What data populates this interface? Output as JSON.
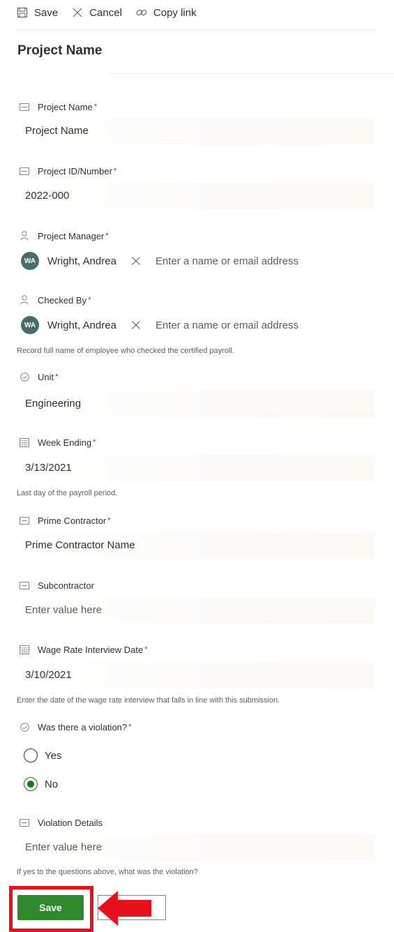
{
  "toolbar": {
    "save_label": "Save",
    "cancel_label": "Cancel",
    "copy_link_label": "Copy link"
  },
  "page_title": "Project Name",
  "required_marker": "*",
  "fields": {
    "project_name": {
      "label": "Project Name",
      "required": true,
      "value": "Project Name"
    },
    "project_id": {
      "label": "Project ID/Number",
      "required": true,
      "value": "2022-000"
    },
    "project_manager": {
      "label": "Project Manager",
      "required": true,
      "person_initials": "WA",
      "person_name": "Wright, Andrea",
      "placeholder": "Enter a name or email address"
    },
    "checked_by": {
      "label": "Checked By",
      "required": true,
      "person_initials": "WA",
      "person_name": "Wright, Andrea",
      "placeholder": "Enter a name or email address",
      "help": "Record full name of employee who checked the certified payroll."
    },
    "unit": {
      "label": "Unit",
      "required": true,
      "value": "Engineering"
    },
    "week_ending": {
      "label": "Week Ending",
      "required": true,
      "value": "3/13/2021",
      "help": "Last day of the payroll period."
    },
    "prime_contractor": {
      "label": "Prime Contractor",
      "required": true,
      "value": "Prime Contractor Name"
    },
    "subcontractor": {
      "label": "Subcontractor",
      "required": false,
      "placeholder": "Enter value here"
    },
    "wage_rate_interview_date": {
      "label": "Wage Rate Interview Date",
      "required": true,
      "value": "3/10/2021",
      "help": "Enter the date of the wage rate interview that falls in line with this submission."
    },
    "violation": {
      "label": "Was there a violation?",
      "required": true,
      "options": [
        "Yes",
        "No"
      ],
      "selected": "No"
    },
    "violation_details": {
      "label": "Violation Details",
      "required": false,
      "placeholder": "Enter value here",
      "help": "If yes to the questions above, what was the violation?"
    }
  },
  "footer": {
    "save_label": "Save",
    "cancel_label": ""
  },
  "colors": {
    "save_green": "#2f8a2f",
    "highlight_red": "#e8101c",
    "avatar_bg": "#486b6c",
    "radio_checked": "#107c10"
  },
  "icons": {
    "save": "save-icon",
    "cancel": "close-icon",
    "copy_link": "link-icon",
    "text_field": "text-field-icon",
    "person": "person-icon",
    "choice": "choice-icon",
    "calendar": "calendar-icon",
    "arrow": "arrow-left-icon"
  }
}
